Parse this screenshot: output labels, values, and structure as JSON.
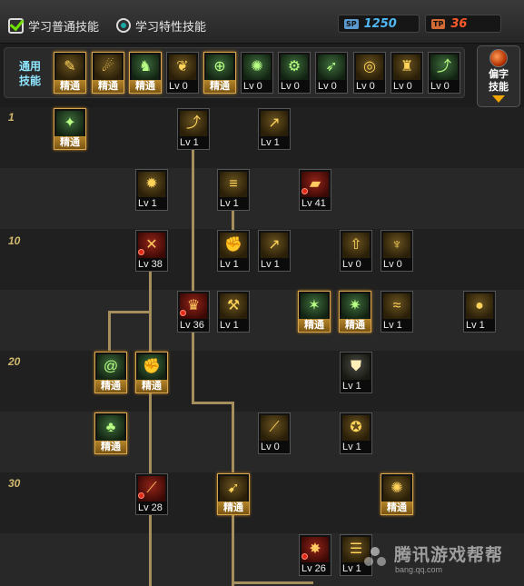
{
  "tabs": [
    {
      "label": "学习普通技能",
      "icon": "checkbox-checked-icon"
    },
    {
      "label": "学习特性技能",
      "icon": "radio-selected-icon"
    }
  ],
  "points": {
    "sp": {
      "tag": "SP",
      "value": "1250",
      "color": "#4fb8f5"
    },
    "tp": {
      "tag": "TP",
      "value": "36",
      "color": "#ff5a2a"
    }
  },
  "general": {
    "label": [
      "通用",
      "技能"
    ],
    "skills": [
      {
        "icon": "reading-figure-icon",
        "style": "gold",
        "caption": "精通",
        "mastered": true
      },
      {
        "icon": "dodge-figure-icon",
        "style": "gold",
        "caption": "精通",
        "mastered": true
      },
      {
        "icon": "running-figure-icon",
        "style": "green",
        "caption": "精通",
        "mastered": true
      },
      {
        "icon": "wings-emblem-icon",
        "style": "gold",
        "caption": "Lv 0",
        "mastered": false
      },
      {
        "icon": "target-crosshair-icon",
        "style": "green",
        "caption": "精通",
        "mastered": true
      },
      {
        "icon": "radar-orb-icon",
        "style": "green",
        "caption": "Lv 0",
        "mastered": false
      },
      {
        "icon": "gear-figure-icon",
        "style": "green",
        "caption": "Lv 0",
        "mastered": false
      },
      {
        "icon": "flying-figure-icon",
        "style": "green",
        "caption": "Lv 0",
        "mastered": false
      },
      {
        "icon": "swirl-eye-icon",
        "style": "gold",
        "caption": "Lv 0",
        "mastered": false
      },
      {
        "icon": "armored-warrior-icon",
        "style": "gold",
        "caption": "Lv 0",
        "mastered": false
      },
      {
        "icon": "leaping-figure-icon",
        "style": "green",
        "caption": "Lv 0",
        "mastered": false
      }
    ]
  },
  "exclusive_button": {
    "label": [
      "偏字",
      "技能"
    ],
    "icon": "flame-orb-icon",
    "arrow_icon": "chevron-down-icon"
  },
  "levels": [
    "1",
    "10",
    "20",
    "30"
  ],
  "tree": [
    {
      "name": "tree-skill-r0-a",
      "icon": "green-strike-icon",
      "style": "green",
      "caption": "精通",
      "mastered": true
    },
    {
      "name": "tree-skill-r0-b",
      "icon": "upward-arrow-icon",
      "style": "gold",
      "caption": "Lv 1",
      "mastered": false
    },
    {
      "name": "tree-skill-r0-c",
      "icon": "kick-figure-icon",
      "style": "gold",
      "caption": "Lv 1",
      "mastered": false
    },
    {
      "name": "tree-skill-r1-a",
      "icon": "burst-icon",
      "style": "gold",
      "caption": "Lv 1",
      "mastered": false
    },
    {
      "name": "tree-skill-r1-b",
      "icon": "dash-lines-icon",
      "style": "gold",
      "caption": "Lv 1",
      "mastered": false
    },
    {
      "name": "tree-skill-r1-c",
      "icon": "cannon-icon",
      "style": "red",
      "caption": "Lv 41",
      "mastered": false,
      "marked": true
    },
    {
      "name": "tree-skill-r2-a",
      "icon": "red-slash-icon",
      "style": "red",
      "caption": "Lv 38",
      "mastered": false,
      "marked": true
    },
    {
      "name": "tree-skill-r2-b",
      "icon": "flame-fist-icon",
      "style": "gold",
      "caption": "Lv 1",
      "mastered": false
    },
    {
      "name": "tree-skill-r2-c",
      "icon": "spear-thrust-icon",
      "style": "gold",
      "caption": "Lv 1",
      "mastered": false
    },
    {
      "name": "tree-skill-r2-d",
      "icon": "rise-arrow-icon",
      "style": "gold",
      "caption": "Lv 0",
      "mastered": false
    },
    {
      "name": "tree-skill-r2-e",
      "icon": "demon-mask-icon",
      "style": "gold",
      "caption": "Lv 0",
      "mastered": false
    },
    {
      "name": "tree-skill-r3-a",
      "icon": "red-warrior-icon",
      "style": "red",
      "caption": "Lv 36",
      "mastered": false,
      "marked": true
    },
    {
      "name": "tree-skill-r3-b",
      "icon": "axe-swing-icon",
      "style": "gold",
      "caption": "Lv 1",
      "mastered": false
    },
    {
      "name": "tree-skill-r3-c",
      "icon": "green-claw-icon",
      "style": "green",
      "caption": "精通",
      "mastered": true
    },
    {
      "name": "tree-skill-r3-d",
      "icon": "green-blast-icon",
      "style": "green",
      "caption": "精通",
      "mastered": true
    },
    {
      "name": "tree-skill-r3-e",
      "icon": "ground-wave-icon",
      "style": "gold",
      "caption": "Lv 1",
      "mastered": false
    },
    {
      "name": "tree-skill-r3-f",
      "icon": "grenade-icon",
      "style": "gold",
      "caption": "Lv 1",
      "mastered": false
    },
    {
      "name": "tree-skill-r4-a",
      "icon": "green-swirl-icon",
      "style": "green",
      "caption": "精通",
      "mastered": true
    },
    {
      "name": "tree-skill-r4-b",
      "icon": "green-fist-icon",
      "style": "green",
      "caption": "精通",
      "mastered": true
    },
    {
      "name": "tree-skill-r4-c",
      "icon": "shield-icon",
      "style": "white",
      "caption": "Lv 1",
      "mastered": false
    },
    {
      "name": "tree-skill-r5-a",
      "icon": "green-spirit-icon",
      "style": "green",
      "caption": "精通",
      "mastered": true
    },
    {
      "name": "tree-skill-r5-b",
      "icon": "blade-slash-icon",
      "style": "gold",
      "caption": "Lv 0",
      "mastered": false
    },
    {
      "name": "tree-skill-r5-c",
      "icon": "brawler-figure-icon",
      "style": "gold",
      "caption": "Lv 1",
      "mastered": false
    },
    {
      "name": "tree-skill-r6-a",
      "icon": "red-blade-icon",
      "style": "red",
      "caption": "Lv 28",
      "mastered": false,
      "marked": true
    },
    {
      "name": "tree-skill-r6-b",
      "icon": "gold-kick-icon",
      "style": "gold",
      "caption": "精通",
      "mastered": true
    },
    {
      "name": "tree-skill-r6-c",
      "icon": "gold-fury-icon",
      "style": "gold",
      "caption": "精通",
      "mastered": true
    },
    {
      "name": "tree-skill-r7-a",
      "icon": "red-explosion-icon",
      "style": "red",
      "caption": "Lv 26",
      "mastered": false,
      "marked": true
    },
    {
      "name": "tree-skill-r7-b",
      "icon": "scroll-figure-icon",
      "style": "gold",
      "caption": "Lv 1",
      "mastered": false
    }
  ],
  "watermark": {
    "title": "腾讯游戏帮帮",
    "url": "bang.qq.com",
    "icon": "bangbang-logo-icon"
  }
}
